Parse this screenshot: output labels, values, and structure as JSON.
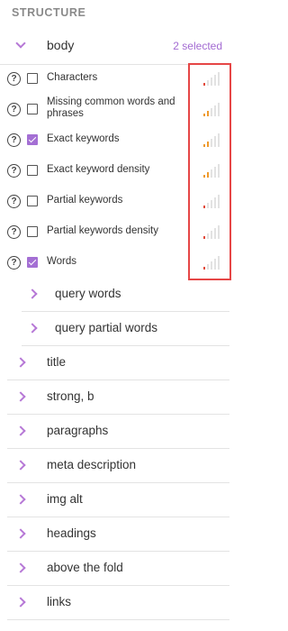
{
  "section_title": "STRUCTURE",
  "body": {
    "label": "body",
    "selected_text": "2 selected"
  },
  "items": [
    {
      "label": "Characters",
      "checked": false,
      "bars": [
        "#e14a3b",
        "#e2e2e2",
        "#e2e2e2",
        "#e2e2e2",
        "#e2e2e2"
      ]
    },
    {
      "label": "Missing common words and phrases",
      "checked": false,
      "bars": [
        "#ef9a2c",
        "#ef9a2c",
        "#e2e2e2",
        "#e2e2e2",
        "#e2e2e2"
      ]
    },
    {
      "label": "Exact keywords",
      "checked": true,
      "bars": [
        "#ef9a2c",
        "#ef9a2c",
        "#e2e2e2",
        "#e2e2e2",
        "#e2e2e2"
      ]
    },
    {
      "label": "Exact keyword density",
      "checked": false,
      "bars": [
        "#ef9a2c",
        "#ef9a2c",
        "#e2e2e2",
        "#e2e2e2",
        "#e2e2e2"
      ]
    },
    {
      "label": "Partial keywords",
      "checked": false,
      "bars": [
        "#e14a3b",
        "#e2e2e2",
        "#e2e2e2",
        "#e2e2e2",
        "#e2e2e2"
      ]
    },
    {
      "label": "Partial keywords density",
      "checked": false,
      "bars": [
        "#e14a3b",
        "#e2e2e2",
        "#e2e2e2",
        "#e2e2e2",
        "#e2e2e2"
      ]
    },
    {
      "label": "Words",
      "checked": true,
      "bars": [
        "#e14a3b",
        "#e2e2e2",
        "#e2e2e2",
        "#e2e2e2",
        "#e2e2e2"
      ]
    }
  ],
  "subgroups": [
    {
      "label": "query words"
    },
    {
      "label": "query partial words"
    }
  ],
  "groups": [
    {
      "label": "title"
    },
    {
      "label": "strong, b"
    },
    {
      "label": "paragraphs"
    },
    {
      "label": "meta description"
    },
    {
      "label": "img alt"
    },
    {
      "label": "headings"
    },
    {
      "label": "above the fold"
    },
    {
      "label": "links"
    }
  ],
  "help_glyph": "?",
  "icons": {
    "help": "question-circle-icon",
    "expand": "chevron-right-icon",
    "collapse": "chevron-down-icon"
  },
  "colors": {
    "accent": "#a46fd4",
    "bar_red": "#e14a3b",
    "bar_orange": "#ef9a2c",
    "highlight": "#e64646"
  }
}
